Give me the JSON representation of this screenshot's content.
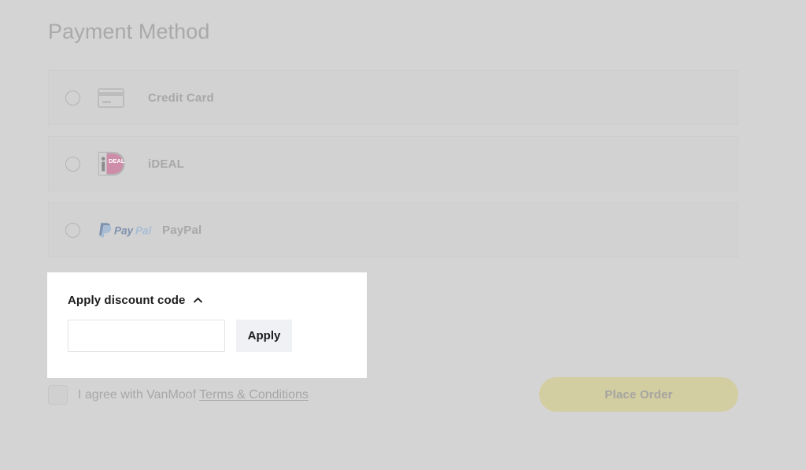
{
  "page": {
    "title": "Payment Method",
    "background_color": "#d4d4d4"
  },
  "payment_methods": {
    "options": [
      {
        "id": "credit-card",
        "label": "Credit Card",
        "logo": "credit-card-icon",
        "selected": false
      },
      {
        "id": "ideal",
        "label": "iDEAL",
        "logo": "ideal-logo-icon",
        "selected": false
      },
      {
        "id": "paypal",
        "label": "PayPal",
        "logo": "paypal-logo-icon",
        "selected": false
      }
    ]
  },
  "discount": {
    "title": "Apply discount code",
    "chevron": "chevron-up-icon",
    "input_value": "",
    "input_placeholder": "",
    "apply_label": "Apply"
  },
  "terms": {
    "checked": false,
    "text_prefix": "I agree with VanMoof ",
    "link_label": "Terms & Conditions"
  },
  "actions": {
    "place_order_label": "Place Order",
    "place_order_color": "#d3cda2"
  },
  "colors": {
    "row_background": "#d2d2d2",
    "panel_background": "#ffffff",
    "apply_button_background": "#f0f1f5",
    "ideal_pink": "#cd8ca8",
    "paypal_blue_dark": "#7f91ad",
    "paypal_blue_light": "#a8bdd4"
  }
}
